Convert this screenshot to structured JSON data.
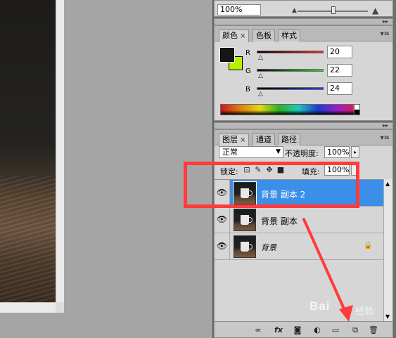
{
  "navigator": {
    "zoom_value": "100%"
  },
  "color_panel": {
    "tabs": [
      {
        "label": "颜色",
        "closable": true,
        "active": true
      },
      {
        "label": "色板",
        "closable": false,
        "active": false
      },
      {
        "label": "样式",
        "closable": false,
        "active": false
      }
    ],
    "channels": [
      {
        "label": "R",
        "value": "20",
        "colors": [
          "#000000",
          "#ff2020"
        ]
      },
      {
        "label": "G",
        "value": "22",
        "colors": [
          "#000000",
          "#22e022"
        ]
      },
      {
        "label": "B",
        "value": "24",
        "colors": [
          "#000000",
          "#2040ff"
        ]
      }
    ],
    "foreground_color": "#141618",
    "background_color": "#b6f100"
  },
  "layers_panel": {
    "tabs": [
      {
        "label": "图层",
        "closable": true,
        "active": true
      },
      {
        "label": "通道",
        "closable": false,
        "active": false
      },
      {
        "label": "路径",
        "closable": false,
        "active": false
      }
    ],
    "blend_mode": "正常",
    "opacity_label": "不透明度:",
    "opacity_value": "100%",
    "lock_label": "锁定:",
    "fill_label": "填充:",
    "fill_value": "100%",
    "layers": [
      {
        "name": "背景 副本 2",
        "selected": true,
        "visible": true,
        "locked": false,
        "italic": false
      },
      {
        "name": "背景 副本",
        "selected": false,
        "visible": true,
        "locked": false,
        "italic": false
      },
      {
        "name": "背景",
        "selected": false,
        "visible": true,
        "locked": true,
        "italic": true
      }
    ],
    "footer_icons": [
      "link-icon",
      "fx-icon",
      "mask-icon",
      "adjustment-icon",
      "group-folder-icon",
      "new-layer-icon",
      "trash-icon"
    ],
    "fx_label": "fx"
  },
  "annotation": {
    "color": "#ff3b3b"
  },
  "watermark": {
    "brand": "Bai",
    "brand_suffix": "经验"
  }
}
